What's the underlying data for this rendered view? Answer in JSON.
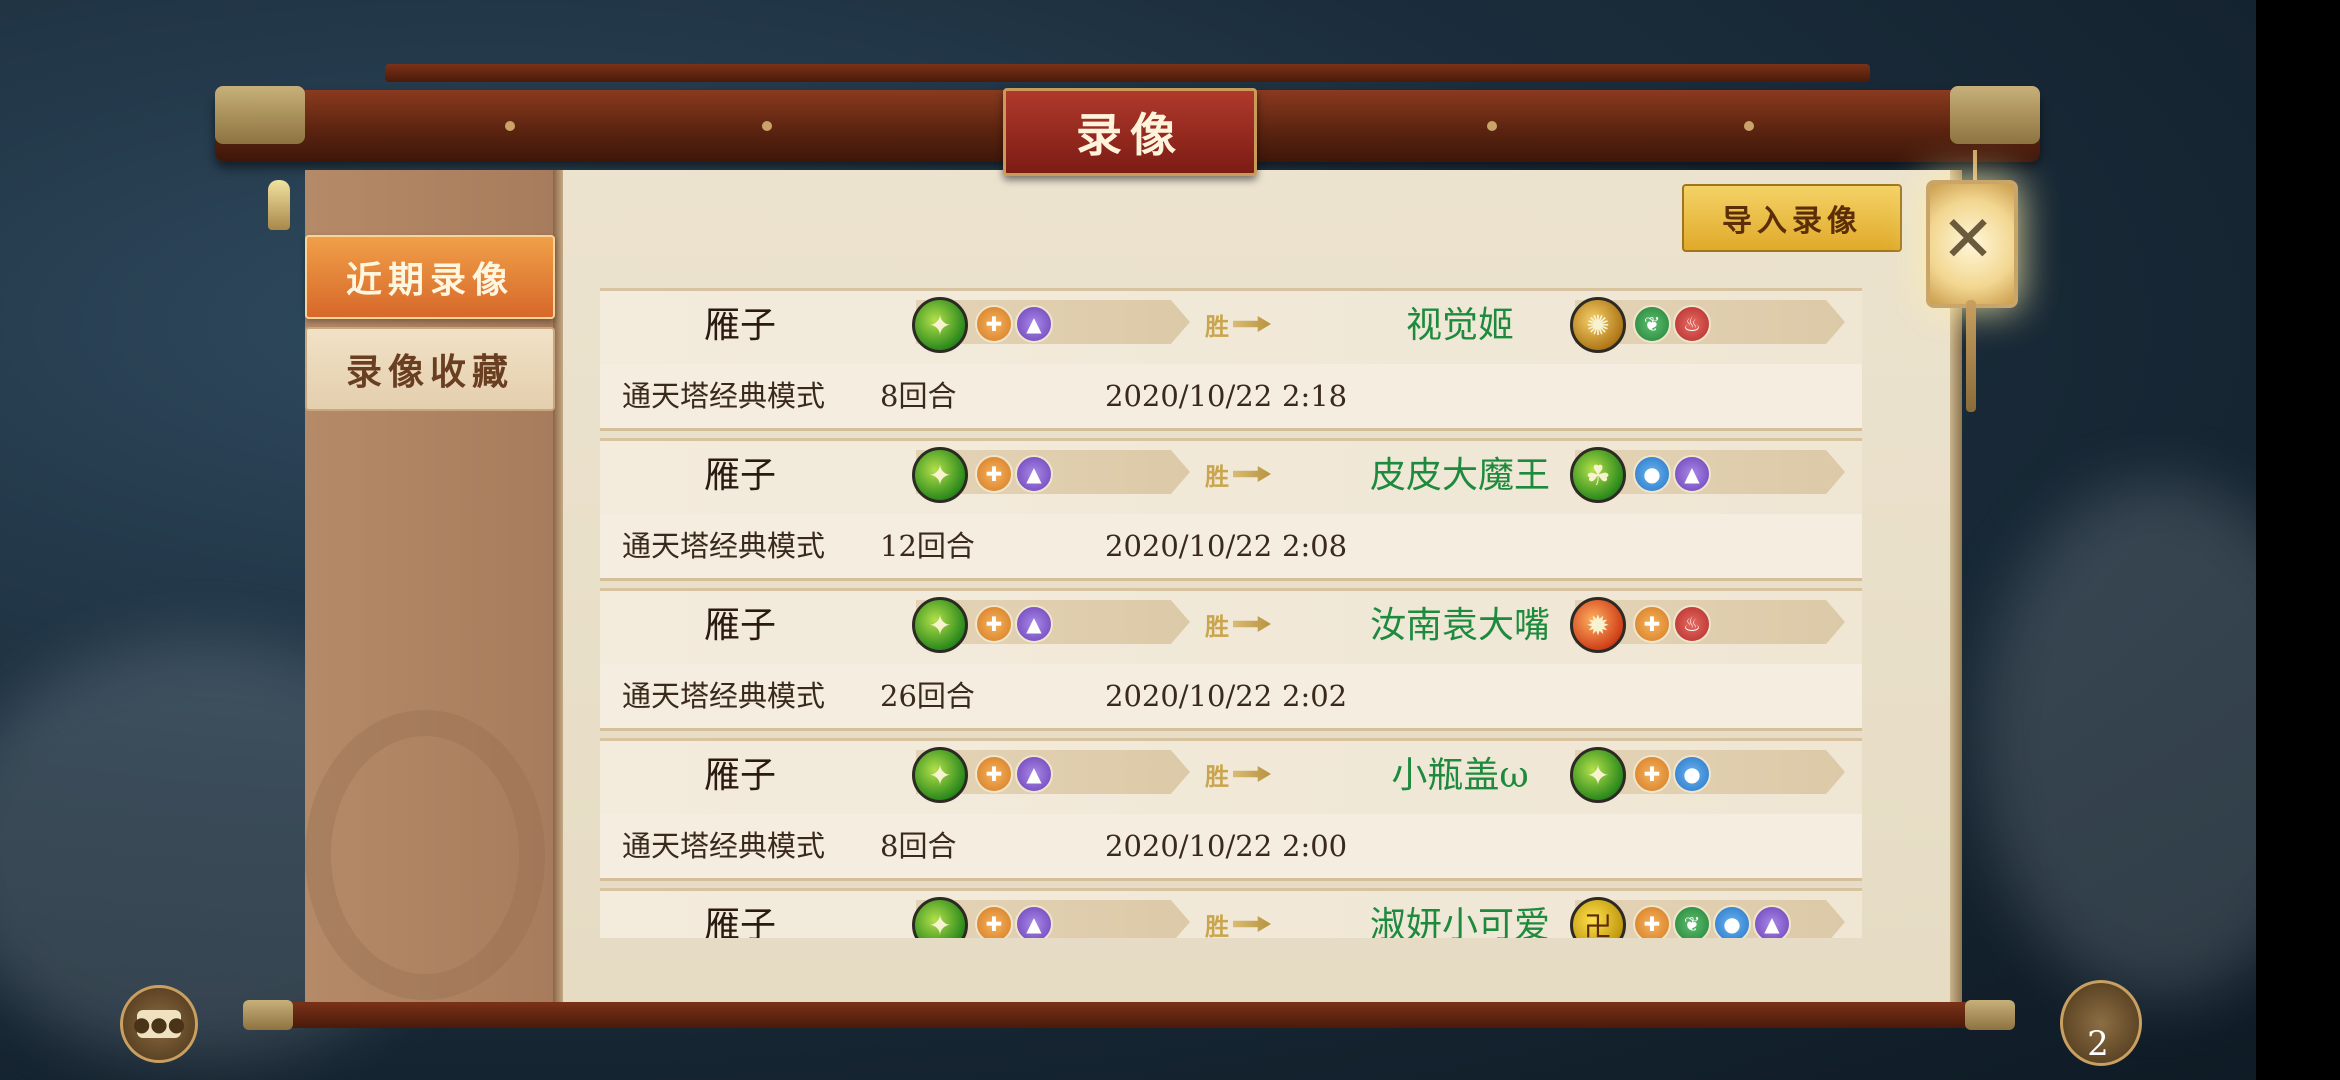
{
  "title": "录像",
  "tabs": [
    {
      "label": "近期录像",
      "active": true
    },
    {
      "label": "录像收藏",
      "active": false
    }
  ],
  "import_button": "导入录像",
  "close_label": "✕",
  "win_label": "胜",
  "records": [
    {
      "player1": "雁子",
      "player2": "视觉姬",
      "mode": "通天塔经典模式",
      "rounds": "8回合",
      "date": "2020/10/22",
      "time": "2:18"
    },
    {
      "player1": "雁子",
      "player2": "皮皮大魔王",
      "mode": "通天塔经典模式",
      "rounds": "12回合",
      "date": "2020/10/22",
      "time": "2:08"
    },
    {
      "player1": "雁子",
      "player2": "汝南袁大嘴",
      "mode": "通天塔经典模式",
      "rounds": "26回合",
      "date": "2020/10/22",
      "time": "2:02"
    },
    {
      "player1": "雁子",
      "player2": "小瓶盖ω",
      "mode": "通天塔经典模式",
      "rounds": "8回合",
      "date": "2020/10/22",
      "time": "2:00"
    },
    {
      "player1": "雁子",
      "player2": "淑妍小可爱",
      "mode": "",
      "rounds": "",
      "date": "",
      "time": ""
    }
  ],
  "bag_count": "2"
}
